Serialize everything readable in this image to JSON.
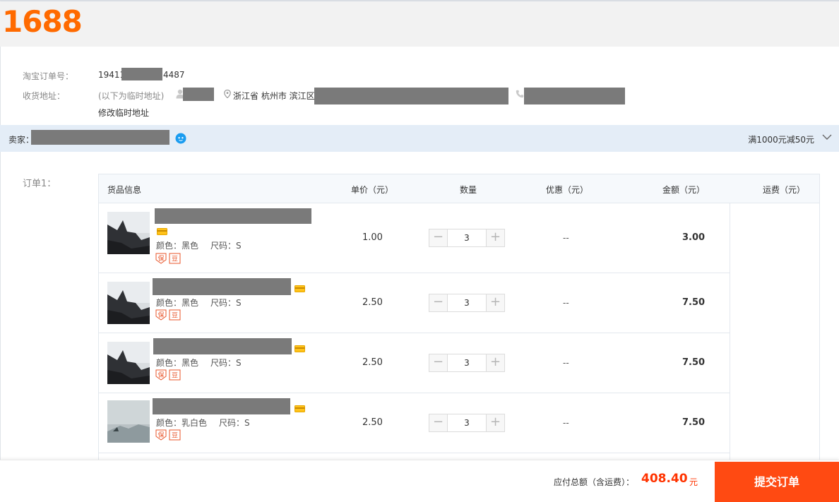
{
  "header": {
    "logo_text": "1688"
  },
  "order_info": {
    "taobao_order_label": "淘宝订单号：",
    "order_no_prefix": "19411",
    "order_no_suffix": "4487",
    "address_label": "收货地址：",
    "temp_address_note": "(以下为临时地址)",
    "address_region": "浙江省 杭州市 滨江区",
    "edit_temp_address_link": "修改临时地址"
  },
  "seller": {
    "label": "卖家：",
    "promotion": "满1000元减50元"
  },
  "order": {
    "label": "订单1：",
    "columns": [
      "货品信息",
      "单价（元）",
      "数量",
      "优惠（元）",
      "金额（元）",
      "运费（元）"
    ],
    "items": [
      {
        "color_spec": "颜色：黑色",
        "size_spec": "尺码：S",
        "unit_price": "1.00",
        "quantity": "3",
        "discount": "--",
        "amount": "3.00"
      },
      {
        "color_spec": "颜色：黑色",
        "size_spec": "尺码：S",
        "unit_price": "2.50",
        "quantity": "3",
        "discount": "--",
        "amount": "7.50"
      },
      {
        "color_spec": "颜色：黑色",
        "size_spec": "尺码：S",
        "unit_price": "2.50",
        "quantity": "3",
        "discount": "--",
        "amount": "7.50"
      },
      {
        "color_spec": "颜色：乳白色",
        "size_spec": "尺码：S",
        "unit_price": "2.50",
        "quantity": "3",
        "discount": "--",
        "amount": "7.50"
      }
    ],
    "qty_minus": "−",
    "qty_plus": "+"
  },
  "footer": {
    "total_label": "应付总额（含运费）：",
    "total_value": "408.40",
    "total_unit": "元",
    "submit_label": "提交订单"
  },
  "colors": {
    "brand_orange": "#ff6a00",
    "submit_bg": "#ff4a12",
    "total_red": "#ff3300",
    "seller_bar_bg": "#e4edf7"
  },
  "icons": [
    "user-icon",
    "location-pin-icon",
    "phone-icon",
    "chat-icon",
    "chevron-down-icon",
    "card-badge-icon",
    "guarantee-badge-icon"
  ]
}
